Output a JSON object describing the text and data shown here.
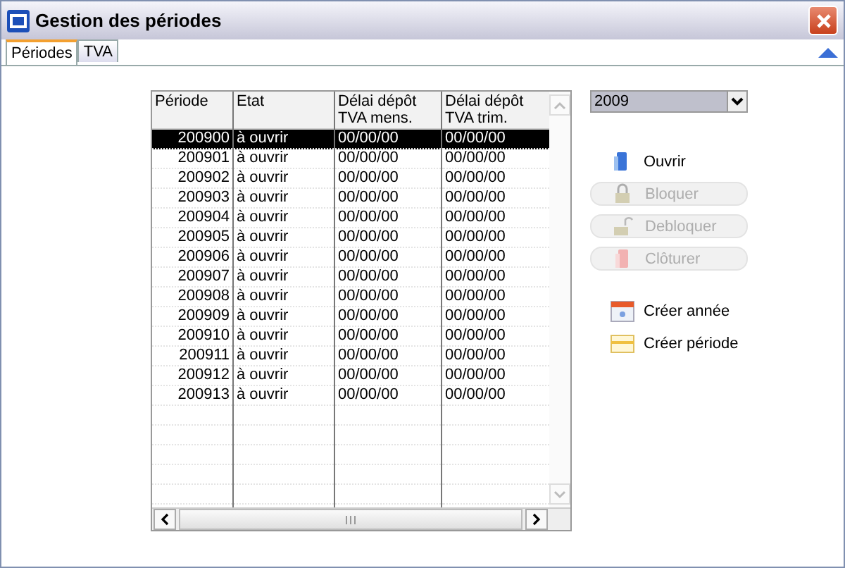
{
  "window": {
    "title": "Gestion des périodes"
  },
  "tabs": [
    {
      "label": "Périodes",
      "selected": true
    },
    {
      "label": "TVA",
      "selected": false
    }
  ],
  "table": {
    "columns": [
      "Période",
      "Etat",
      "Délai dépôt TVA mens.",
      "Délai dépôt TVA trim."
    ],
    "rows": [
      {
        "cells": [
          "200900",
          "à ouvrir",
          "00/00/00",
          "00/00/00"
        ],
        "selected": true
      },
      {
        "cells": [
          "200901",
          "à ouvrir",
          "00/00/00",
          "00/00/00"
        ],
        "selected": false
      },
      {
        "cells": [
          "200902",
          "à ouvrir",
          "00/00/00",
          "00/00/00"
        ],
        "selected": false
      },
      {
        "cells": [
          "200903",
          "à ouvrir",
          "00/00/00",
          "00/00/00"
        ],
        "selected": false
      },
      {
        "cells": [
          "200904",
          "à ouvrir",
          "00/00/00",
          "00/00/00"
        ],
        "selected": false
      },
      {
        "cells": [
          "200905",
          "à ouvrir",
          "00/00/00",
          "00/00/00"
        ],
        "selected": false
      },
      {
        "cells": [
          "200906",
          "à ouvrir",
          "00/00/00",
          "00/00/00"
        ],
        "selected": false
      },
      {
        "cells": [
          "200907",
          "à ouvrir",
          "00/00/00",
          "00/00/00"
        ],
        "selected": false
      },
      {
        "cells": [
          "200908",
          "à ouvrir",
          "00/00/00",
          "00/00/00"
        ],
        "selected": false
      },
      {
        "cells": [
          "200909",
          "à ouvrir",
          "00/00/00",
          "00/00/00"
        ],
        "selected": false
      },
      {
        "cells": [
          "200910",
          "à ouvrir",
          "00/00/00",
          "00/00/00"
        ],
        "selected": false
      },
      {
        "cells": [
          "200911",
          "à ouvrir",
          "00/00/00",
          "00/00/00"
        ],
        "selected": false
      },
      {
        "cells": [
          "200912",
          "à ouvrir",
          "00/00/00",
          "00/00/00"
        ],
        "selected": false
      },
      {
        "cells": [
          "200913",
          "à ouvrir",
          "00/00/00",
          "00/00/00"
        ],
        "selected": false
      }
    ]
  },
  "year_select": {
    "value": "2009"
  },
  "actions": [
    {
      "label": "Ouvrir",
      "kind": "open",
      "disabled": false
    },
    {
      "label": "Bloquer",
      "kind": "lock",
      "disabled": true
    },
    {
      "label": "Debloquer",
      "kind": "unlock",
      "disabled": true
    },
    {
      "label": "Clôturer",
      "kind": "close",
      "disabled": true
    }
  ],
  "create_actions": [
    {
      "label": "Créer année",
      "kind": "calendar"
    },
    {
      "label": "Créer période",
      "kind": "period"
    }
  ]
}
